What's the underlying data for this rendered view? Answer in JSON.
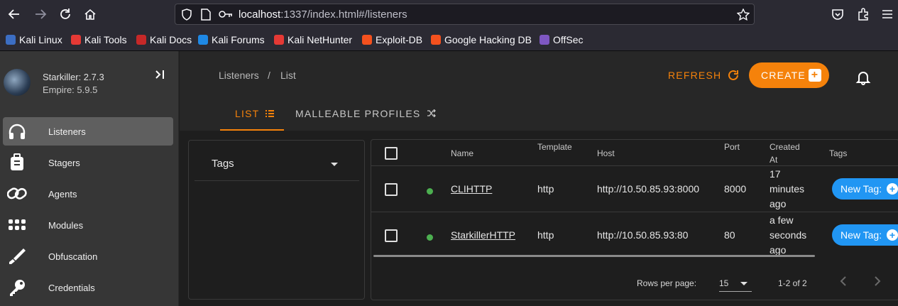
{
  "browser": {
    "url_host": "localhost",
    "url_rest": ":1337/index.html#/listeners",
    "bookmarks": [
      {
        "label": "Kali Linux",
        "color": "#3c6ec4"
      },
      {
        "label": "Kali Tools",
        "color": "#e53935"
      },
      {
        "label": "Kali Docs",
        "color": "#c62828"
      },
      {
        "label": "Kali Forums",
        "color": "#1e88e5"
      },
      {
        "label": "Kali NetHunter",
        "color": "#e53935"
      },
      {
        "label": "Exploit-DB",
        "color": "#f4511e"
      },
      {
        "label": "Google Hacking DB",
        "color": "#f4511e"
      },
      {
        "label": "OffSec",
        "color": "#7e57c2"
      }
    ]
  },
  "sidebar": {
    "app_name": "Starkiller: 2.7.3",
    "empire_version": "Empire: 5.9.5",
    "items": [
      {
        "label": "Listeners",
        "icon": "headphones-icon"
      },
      {
        "label": "Stagers",
        "icon": "luggage-icon"
      },
      {
        "label": "Agents",
        "icon": "link-icon"
      },
      {
        "label": "Modules",
        "icon": "grid-dots-icon"
      },
      {
        "label": "Obfuscation",
        "icon": "brush-icon"
      },
      {
        "label": "Credentials",
        "icon": "key-icon"
      }
    ]
  },
  "header": {
    "breadcrumb": [
      "Listeners",
      "List"
    ],
    "refresh_label": "REFRESH",
    "create_label": "CREATE"
  },
  "tabs": [
    {
      "label": "LIST"
    },
    {
      "label": "MALLEABLE PROFILES"
    }
  ],
  "filters": {
    "tags_label": "Tags"
  },
  "table": {
    "columns": [
      "Name",
      "Template",
      "Host",
      "Port",
      "Created At",
      "Tags"
    ],
    "rows": [
      {
        "name": "CLIHTTP",
        "template": "http",
        "host": "http://10.50.85.93:8000",
        "port": "8000",
        "created_lines": [
          "17",
          "minutes",
          "ago"
        ],
        "tag_button": "New Tag:"
      },
      {
        "name": "StarkillerHTTP",
        "template": "http",
        "host": "http://10.50.85.93:80",
        "port": "80",
        "created_lines": [
          "a few",
          "seconds",
          "ago"
        ],
        "tag_button": "New Tag:"
      }
    ],
    "rows_per_page_label": "Rows per page:",
    "rows_per_page": "15",
    "page_range": "1-2 of 2"
  },
  "colors": {
    "accent": "#f5820b",
    "tag_button": "#2196f3",
    "status_active": "#4caf50"
  }
}
